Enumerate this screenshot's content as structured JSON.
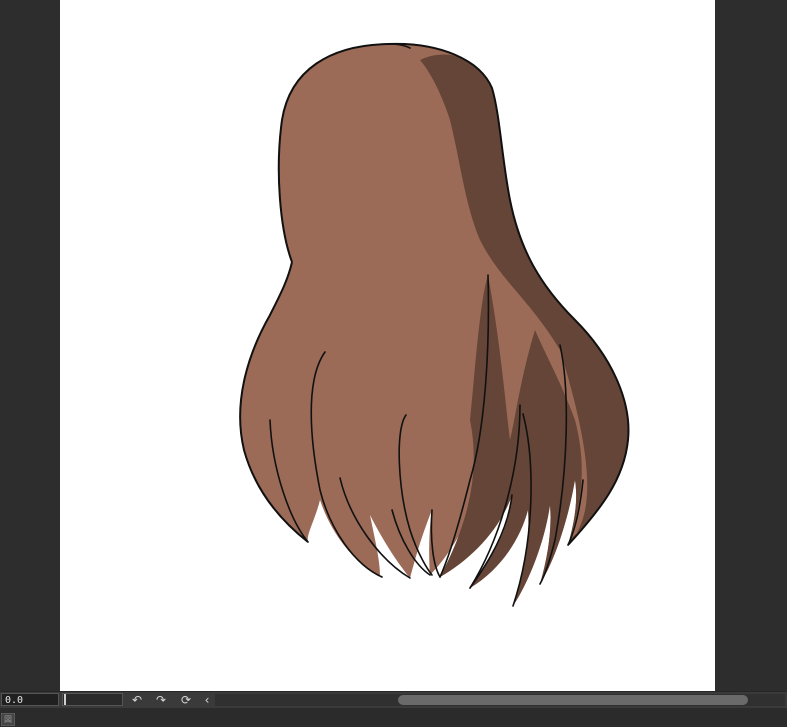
{
  "statusbar": {
    "zoom_value": "0.0",
    "undo_icon": "undo-icon",
    "redo_icon": "redo-icon",
    "rotate_reset_icon": "rotate-reset-icon",
    "collapse_icon": "chevron-left-icon",
    "undo_glyph": "↶",
    "redo_glyph": "↷",
    "rotate_glyph": "⟳",
    "collapse_glyph": "‹"
  },
  "canvas": {
    "background_color": "#ffffff",
    "hair_base_color": "#9b6b57",
    "hair_shadow_color": "#654537",
    "line_color": "#111111"
  },
  "bottom_panel": {
    "layer_icon": "layer-icon",
    "layer_glyph": "図"
  }
}
